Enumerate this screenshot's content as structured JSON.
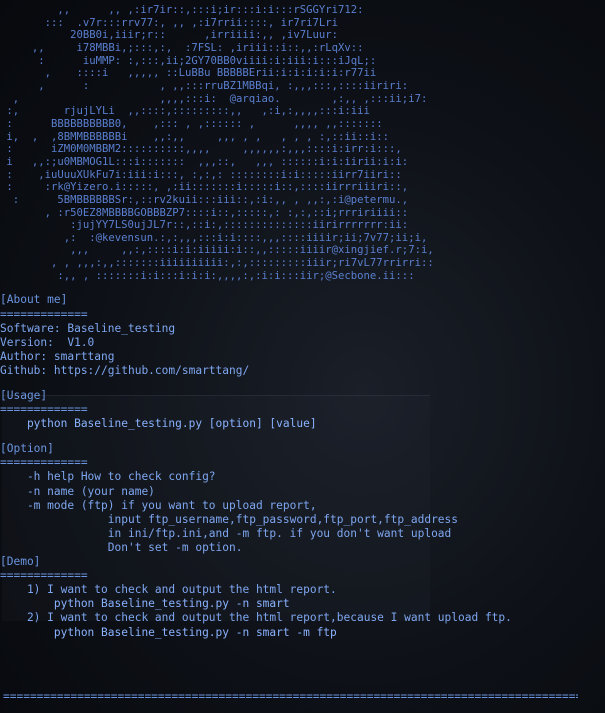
{
  "banner_lines": [
    "         ,,      ,, ,:ir7ir::,:::i;ir:::i:i:::rSGGYri712:",
    "       :::  .v7r:::rrv77:, ,, ,:i7rrii::::, ir7ri7Lri",
    "           20BB0i,iiir;r::      ,irriiii:,, ,iv7Luur:",
    "     ,,     i78MBBi,;:::,:,  :7FSL: ,iriii::i::,,:rLqXv::",
    "      :      iuMMP: :,:::,ii;2GY70BB0viiii:i:iii:i:::iJqL;:",
    "       ,    ::::i   ,,,,, ::LuBBu BBBBBErii:i:i:i:i:i:r77ii",
    "      ,      :           , ,,:::rruBZ1MBBqi, :,,,:::,::::iiriri:",
    "  ,                      ,,,,:::i:  @arqiao.        ,:,, ,:::ii;i7:",
    " :,       rjujLYLi  ,,::::,:::::::::,,   ,:i,:,,,,:::i:iii",
    " :      BBBBBBBBBB0,    ,::: , ,:::::: ,      ,,,, ,,:::::::",
    " i,  ,  ,8BMMBBBBBBi    ,,:,,     ,,, , ,   , , , :,::ii::i::",
    " :      iZM0M0MBBM2::::::::::,,,,     ,,,,,,:,,,::::i:irr:i:::,",
    " i   ,,:;u0MBMOG1L:::i:::::::  ,,,::,   ,,, ::::::i:i:iirii:i:i:",
    " :    ,iuUuuXUkFu7i:iii:i:::, :,:,: ::::::::i:i:::::iirr7iiri::",
    " :     :rk@Yizero.i:::::, ,:ii:::::::i:::::i::,::::iirrriiiri::,",
    "  :      5BMBBBBBBSr:,::rv2kuii:::iii::,:i:,, , ,,:,:i@petermu.,",
    "       , :r50EZ8MBBBBGOBBBZP7::::i::,:::::,: :,:,::i;rrririiii::",
    "           :jujYY7LS0ujJL7r::,::i:,::::::::::::::iirirrrrrrr:ii:",
    "          ,:  :@kevensun.:,:,,,:::i:i::::,,,::::iiiir;ii;7v77;ii;i,",
    "           ,,,     ,,:,::::i:i:iiiii:i::,,:::::iiiir@xingjief.r;7:i,",
    "        , , ,,,:,,:::::::iiiiiiiiii:,:,:::::::::iiir;ri7vL77rrirri::",
    "         :,, , :::::::i:i:::i:i:i:,,,,:,:i:i:::iir;@Secbone.ii:::"
  ],
  "about": {
    "header": "[About me]",
    "separator": "=============",
    "software": "Software: Baseline_testing",
    "version": "Version:  V1.0",
    "author": "Author: smarttang",
    "github": "Github: https://github.com/smarttang/"
  },
  "usage": {
    "header": "[Usage]",
    "separator": "=============",
    "command": "    python Baseline_testing.py [option] [value]"
  },
  "option": {
    "header": "[Option]",
    "separator": "=============",
    "lines": [
      "    -h help How to check config?",
      "    -n name (your name)",
      "    -m mode (ftp) if you want to upload report,",
      "                input ftp_username,ftp_password,ftp_port,ftp_address",
      "                in ini/ftp.ini,and -m ftp. if you don't want upload",
      "                Don't set -m option."
    ]
  },
  "demo": {
    "header": "[Demo]",
    "separator": "=============",
    "lines": [
      "    1) I want to check and output the html report.",
      "        python Baseline_testing.py -n smart",
      "    2) I want to check and output the html report,because I want upload ftp.",
      "        python Baseline_testing.py -n smart -m ftp"
    ]
  },
  "footer_separator": "=========================================================================================",
  "colors": {
    "banner": "#5a7fd0",
    "text": "#7ea6f0",
    "background": "#0d1016"
  }
}
